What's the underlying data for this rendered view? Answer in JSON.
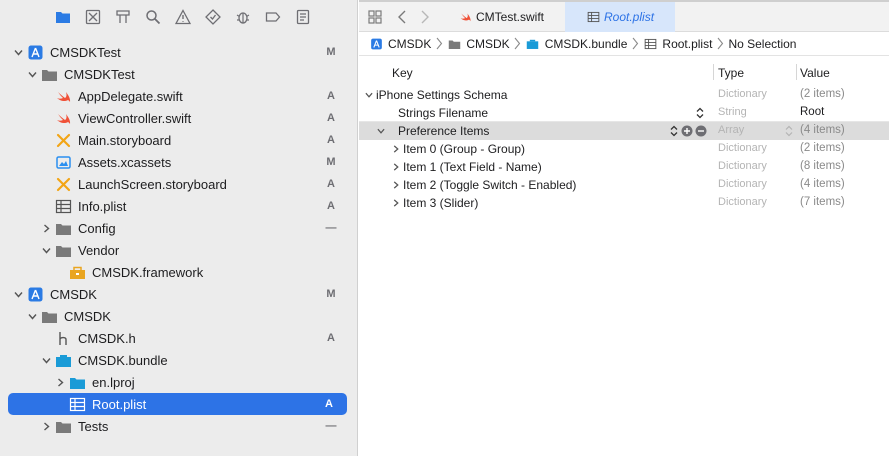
{
  "navigator": {
    "toolbar_icons": [
      "folder-icon",
      "source-control-icon",
      "symbol-icon",
      "search-icon",
      "warning-icon",
      "test-icon",
      "debug-icon",
      "breakpoint-icon",
      "report-icon"
    ],
    "tree": [
      {
        "label": "CMSDKTest",
        "badge": "M",
        "icon": "project-icon",
        "level": 0,
        "disclosure": "open"
      },
      {
        "label": "CMSDKTest",
        "badge": "",
        "icon": "folder-icon",
        "level": 1,
        "disclosure": "open"
      },
      {
        "label": "AppDelegate.swift",
        "badge": "A",
        "icon": "swift-icon",
        "level": 2,
        "disclosure": "none"
      },
      {
        "label": "ViewController.swift",
        "badge": "A",
        "icon": "swift-icon",
        "level": 2,
        "disclosure": "none"
      },
      {
        "label": "Main.storyboard",
        "badge": "A",
        "icon": "storyboard-icon",
        "level": 2,
        "disclosure": "none"
      },
      {
        "label": "Assets.xcassets",
        "badge": "M",
        "icon": "assets-icon",
        "level": 2,
        "disclosure": "none"
      },
      {
        "label": "LaunchScreen.storyboard",
        "badge": "A",
        "icon": "storyboard-icon",
        "level": 2,
        "disclosure": "none"
      },
      {
        "label": "Info.plist",
        "badge": "A",
        "icon": "plist-icon",
        "level": 2,
        "disclosure": "none"
      },
      {
        "label": "Config",
        "badge": "—",
        "icon": "folder-icon",
        "level": 2,
        "disclosure": "closed"
      },
      {
        "label": "Vendor",
        "badge": "",
        "icon": "folder-icon",
        "level": 2,
        "disclosure": "open"
      },
      {
        "label": "CMSDK.framework",
        "badge": "",
        "icon": "framework-icon",
        "level": 3,
        "disclosure": "none"
      },
      {
        "label": "CMSDK",
        "badge": "M",
        "icon": "project-icon",
        "level": 0,
        "disclosure": "open"
      },
      {
        "label": "CMSDK",
        "badge": "",
        "icon": "folder-icon",
        "level": 1,
        "disclosure": "open"
      },
      {
        "label": "CMSDK.h",
        "badge": "A",
        "icon": "header-icon",
        "level": 2,
        "disclosure": "none"
      },
      {
        "label": "CMSDK.bundle",
        "badge": "",
        "icon": "bundle-icon",
        "level": 2,
        "disclosure": "open"
      },
      {
        "label": "en.lproj",
        "badge": "",
        "icon": "blue-folder-icon",
        "level": 3,
        "disclosure": "closed"
      },
      {
        "label": "Root.plist",
        "badge": "A",
        "icon": "plist-icon",
        "level": 3,
        "disclosure": "none",
        "selected": true
      },
      {
        "label": "Tests",
        "badge": "—",
        "icon": "folder-icon",
        "level": 2,
        "disclosure": "closed"
      }
    ]
  },
  "editor": {
    "tabs": [
      {
        "label": "CMTest.swift",
        "icon": "swift-icon",
        "active": false
      },
      {
        "label": "Root.plist",
        "icon": "plist-icon",
        "active": true
      }
    ],
    "breadcrumb": [
      {
        "label": "CMSDK",
        "icon": "project-icon"
      },
      {
        "label": "CMSDK",
        "icon": "folder-icon"
      },
      {
        "label": "CMSDK.bundle",
        "icon": "bundle-icon"
      },
      {
        "label": "Root.plist",
        "icon": "plist-icon"
      },
      {
        "label": "No Selection",
        "icon": ""
      }
    ],
    "columns": {
      "key": "Key",
      "type": "Type",
      "value": "Value"
    },
    "rows": [
      {
        "key": "iPhone Settings Schema",
        "type": "Dictionary",
        "value": "(2 items)",
        "indent": 0,
        "disclosure": "open"
      },
      {
        "key": "Strings Filename",
        "type": "String",
        "value": "Root",
        "indent": 1,
        "disclosure": "none",
        "stepper": true
      },
      {
        "key": "Preference Items",
        "type": "Array",
        "value": "(4 items)",
        "indent": 1,
        "disclosure": "open",
        "highlight": true
      },
      {
        "key": "Item 0 (Group - Group)",
        "type": "Dictionary",
        "value": "(2 items)",
        "indent": 2,
        "disclosure": "closed"
      },
      {
        "key": "Item 1 (Text Field - Name)",
        "type": "Dictionary",
        "value": "(8 items)",
        "indent": 2,
        "disclosure": "closed"
      },
      {
        "key": "Item 2 (Toggle Switch - Enabled)",
        "type": "Dictionary",
        "value": "(4 items)",
        "indent": 2,
        "disclosure": "closed"
      },
      {
        "key": "Item 3 (Slider)",
        "type": "Dictionary",
        "value": "(7 items)",
        "indent": 2,
        "disclosure": "closed"
      }
    ]
  },
  "colors": {
    "accent": "#2d73e6",
    "swift": "#f05138",
    "storyboard": "#f2a516",
    "folder": "#7a7a7a",
    "blue_folder": "#1a9bd7"
  }
}
